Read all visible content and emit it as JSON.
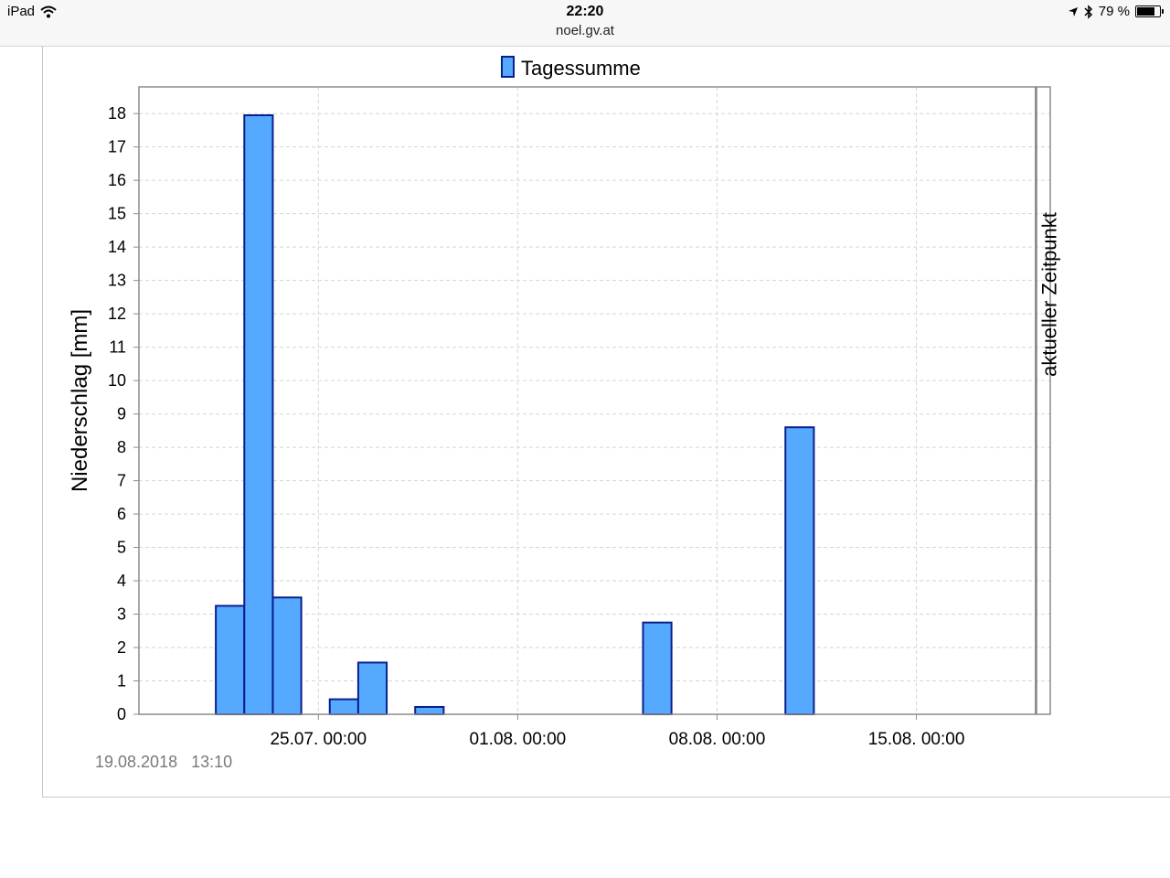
{
  "statusbar": {
    "device": "iPad",
    "time": "22:20",
    "url": "noel.gv.at",
    "battery_text": "79 %",
    "battery_level": 0.79
  },
  "chart_data": {
    "type": "bar",
    "legend": {
      "label": "Tagessumme",
      "placement": "top-center"
    },
    "ylabel": "Niederschlag [mm]",
    "ylim": [
      0,
      18.8
    ],
    "yticks": [
      0,
      1,
      2,
      3,
      4,
      5,
      6,
      7,
      8,
      9,
      10,
      11,
      12,
      13,
      14,
      15,
      16,
      17,
      18
    ],
    "grid": true,
    "x_ticks": [
      "25.07. 00:00",
      "01.08. 00:00",
      "08.08. 00:00",
      "15.08. 00:00"
    ],
    "x_range_days": [
      -6.3,
      25.7
    ],
    "series": [
      {
        "name": "Tagessumme",
        "color": "#55aaff",
        "edge_color": "#0a1e8c",
        "bars": [
          {
            "day": -3.6,
            "value": 3.25
          },
          {
            "day": -2.6,
            "value": 17.95
          },
          {
            "day": -1.6,
            "value": 3.5
          },
          {
            "day": 0.4,
            "value": 0.45
          },
          {
            "day": 1.4,
            "value": 1.55
          },
          {
            "day": 3.4,
            "value": 0.22
          },
          {
            "day": 11.4,
            "value": 2.75
          },
          {
            "day": 16.4,
            "value": 8.6
          }
        ]
      }
    ],
    "bar_width_days": 1,
    "marker": {
      "label": "aktueller Zeitpunkt",
      "day": 25.2,
      "color": "#808080"
    },
    "timestamp": "19.08.2018   13:10"
  }
}
